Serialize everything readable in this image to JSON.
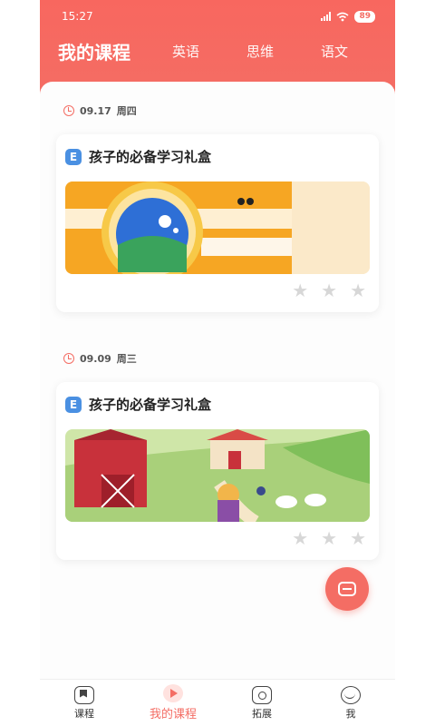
{
  "status_bar": {
    "time": "15:27",
    "battery": "89"
  },
  "header": {
    "title": "我的课程",
    "tabs": [
      "英语",
      "思维",
      "语文"
    ]
  },
  "courses": [
    {
      "date": "09.17",
      "weekday": "周四",
      "badge": "E",
      "title": "孩子的必备学习礼盒",
      "stars_filled": 0,
      "stars_total": 3
    },
    {
      "date": "09.09",
      "weekday": "周三",
      "badge": "E",
      "title": "孩子的必备学习礼盒",
      "stars_filled": 0,
      "stars_total": 3
    }
  ],
  "bottom_nav": [
    {
      "label": "课程",
      "icon": "book-icon"
    },
    {
      "label": "我的课程",
      "icon": "play-icon",
      "active": true
    },
    {
      "label": "拓展",
      "icon": "expand-icon"
    },
    {
      "label": "我",
      "icon": "profile-icon"
    }
  ],
  "colors": {
    "brand": "#f46d64",
    "star_empty": "#d7d7d7",
    "badge_blue": "#4a90e2"
  }
}
